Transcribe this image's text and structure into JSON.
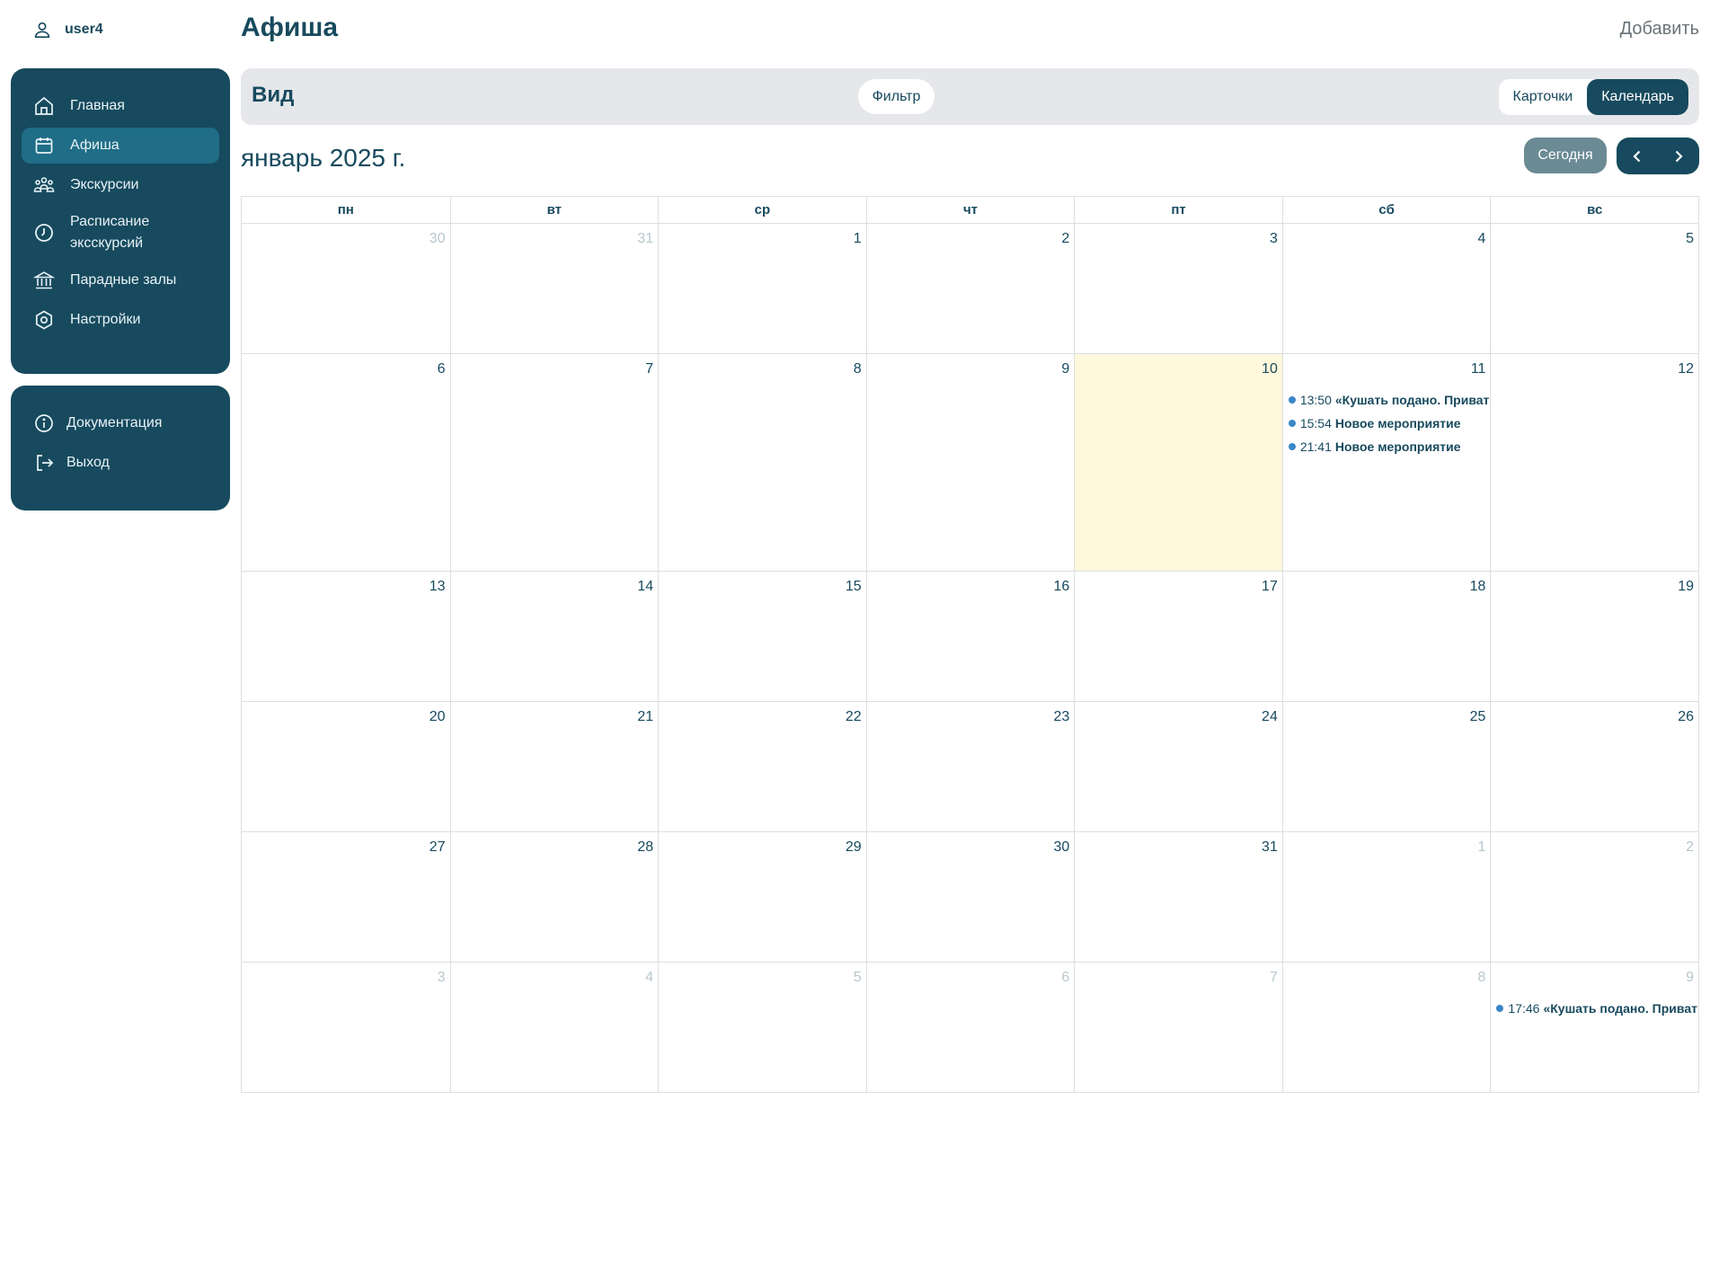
{
  "user": {
    "name": "user4"
  },
  "sidebar": {
    "items": [
      {
        "label": "Главная",
        "icon": "home-icon",
        "active": false
      },
      {
        "label": "Афиша",
        "icon": "calendar-icon",
        "active": true
      },
      {
        "label": "Экскурсии",
        "icon": "group-icon",
        "active": false
      },
      {
        "label": "Расписание эксскурсий",
        "icon": "clock-icon",
        "active": false
      },
      {
        "label": "Парадные залы",
        "icon": "museum-icon",
        "active": false
      },
      {
        "label": "Настройки",
        "icon": "settings-icon",
        "active": false
      }
    ],
    "extra": [
      {
        "label": "Документация",
        "icon": "info-icon"
      },
      {
        "label": "Выход",
        "icon": "logout-icon"
      }
    ]
  },
  "header": {
    "title": "Афиша",
    "add_label": "Добавить"
  },
  "viewbar": {
    "label": "Вид",
    "filter_label": "Фильтр",
    "modes": [
      {
        "label": "Карточки",
        "active": false
      },
      {
        "label": "Календарь",
        "active": true
      }
    ]
  },
  "calendar": {
    "month_label": "январь 2025 г.",
    "today_label": "Сегодня",
    "weekdays": [
      "пн",
      "вт",
      "ср",
      "чт",
      "пт",
      "сб",
      "вс"
    ],
    "weeks": [
      [
        {
          "day": "30",
          "other": true
        },
        {
          "day": "31",
          "other": true
        },
        {
          "day": "1"
        },
        {
          "day": "2"
        },
        {
          "day": "3"
        },
        {
          "day": "4"
        },
        {
          "day": "5"
        }
      ],
      [
        {
          "day": "6"
        },
        {
          "day": "7"
        },
        {
          "day": "8"
        },
        {
          "day": "9"
        },
        {
          "day": "10",
          "today": true
        },
        {
          "day": "11",
          "events": [
            {
              "time": "13:50",
              "title": "«Кушать подано. Приватный ужин"
            },
            {
              "time": "15:54",
              "title": "Новое мероприятие"
            },
            {
              "time": "21:41",
              "title": "Новое мероприятие"
            }
          ]
        },
        {
          "day": "12"
        }
      ],
      [
        {
          "day": "13"
        },
        {
          "day": "14"
        },
        {
          "day": "15"
        },
        {
          "day": "16"
        },
        {
          "day": "17"
        },
        {
          "day": "18"
        },
        {
          "day": "19"
        }
      ],
      [
        {
          "day": "20"
        },
        {
          "day": "21"
        },
        {
          "day": "22"
        },
        {
          "day": "23"
        },
        {
          "day": "24"
        },
        {
          "day": "25"
        },
        {
          "day": "26"
        }
      ],
      [
        {
          "day": "27"
        },
        {
          "day": "28"
        },
        {
          "day": "29"
        },
        {
          "day": "30"
        },
        {
          "day": "31"
        },
        {
          "day": "1",
          "other": true
        },
        {
          "day": "2",
          "other": true
        }
      ],
      [
        {
          "day": "3",
          "other": true
        },
        {
          "day": "4",
          "other": true
        },
        {
          "day": "5",
          "other": true
        },
        {
          "day": "6",
          "other": true
        },
        {
          "day": "7",
          "other": true
        },
        {
          "day": "8",
          "other": true
        },
        {
          "day": "9",
          "other": true,
          "events": [
            {
              "time": "17:46",
              "title": "«Кушать подано. Приватный ужин"
            }
          ]
        }
      ]
    ]
  },
  "colors": {
    "primary": "#174a5e",
    "active_nav": "#1f6d86",
    "today_bg": "#fff8dc",
    "event_dot": "#3a86c8",
    "today_btn": "#6a8a94"
  }
}
